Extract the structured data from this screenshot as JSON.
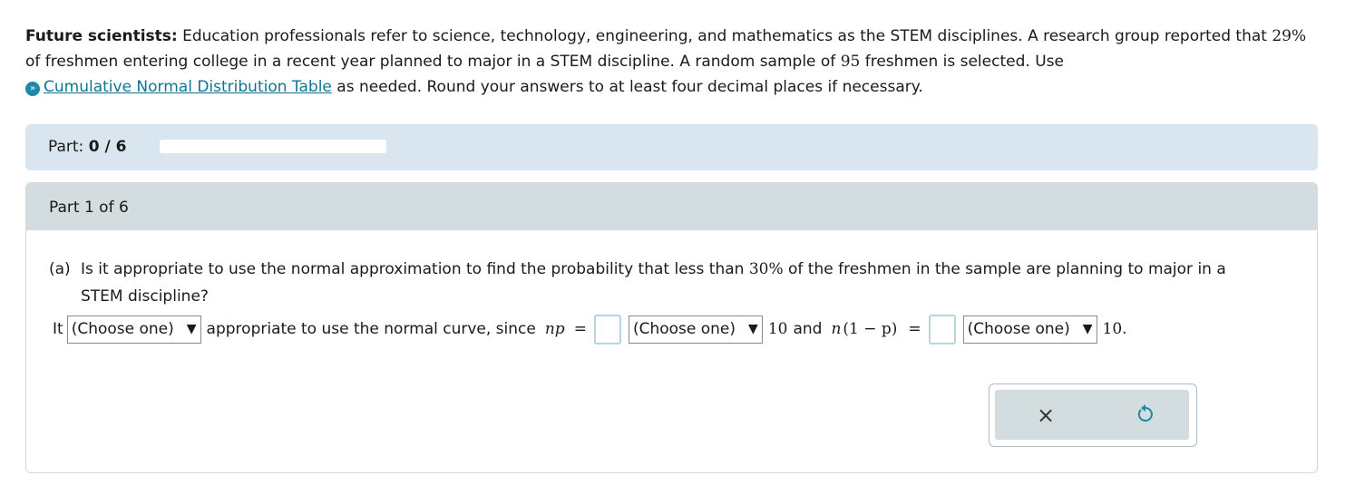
{
  "intro": {
    "heading": "Future scientists:",
    "text1": " Education professionals refer to science, technology, engineering, and mathematics as the STEM disciplines. A research group reported that ",
    "pct": "29%",
    "text2": " of freshmen entering college in a recent year planned to major in a STEM discipline. A random sample of ",
    "n": "95",
    "text3": " freshmen is selected. Use",
    "link_label": "Cumulative Normal Distribution Table",
    "text4": " as needed. Round your answers to at least four decimal places if necessary."
  },
  "progress": {
    "label": "Part: ",
    "value": "0 / 6",
    "fraction": 0
  },
  "part_header": "Part 1 of 6",
  "question": {
    "tag": "(a)",
    "text1": "Is it appropriate to use the normal approximation to find the probability that less than ",
    "pct": "30%",
    "text2": " of the freshmen in the sample are planning to major in a",
    "text3": "STEM discipline?"
  },
  "answer": {
    "it": "It",
    "select1": "(Choose one)",
    "mid": "appropriate to use the normal curve, since",
    "np": "np",
    "eq": "=",
    "select2": "(Choose one)",
    "ten1": "10",
    "and": "and",
    "n_var": "n",
    "paren": "(1 − p)",
    "eq2": "=",
    "select3": "(Choose one)",
    "ten2": "10."
  },
  "actions": {
    "clear": "×"
  }
}
